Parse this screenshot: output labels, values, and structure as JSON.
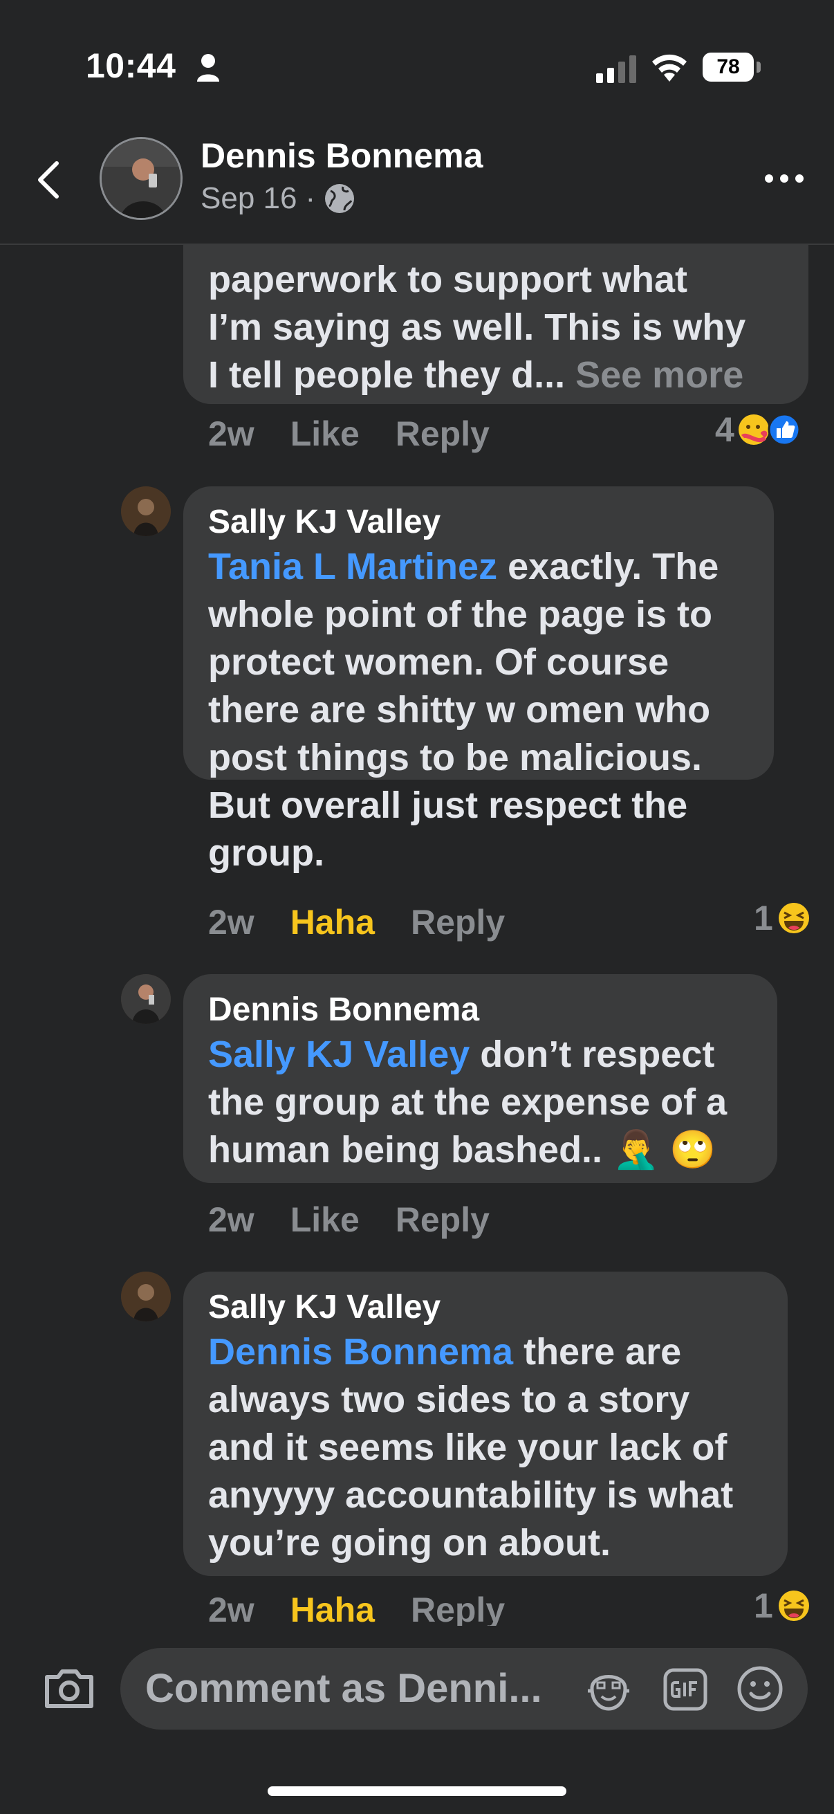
{
  "status_bar": {
    "time": "10:44",
    "battery": "78"
  },
  "header": {
    "name": "Dennis Bonnema",
    "date": "Sep 16",
    "separator": "·"
  },
  "comments": [
    {
      "lines": [
        "paperwork to support what",
        "I’m saying as well. This is why",
        "I tell people they d... "
      ],
      "see_more": "See more",
      "time": "2w",
      "action": "Like",
      "reply": "Reply",
      "reaction_count": "4"
    },
    {
      "author": "Sally KJ Valley",
      "mention": "Tania L Martinez",
      "text_first": " exactly. The",
      "lines": [
        "whole point of the page is to",
        "protect women. Of course",
        "there are shitty w omen who",
        "post things to be malicious.",
        "But overall just respect the",
        "group."
      ],
      "time": "2w",
      "action": "Haha",
      "reply": "Reply",
      "reaction_count": "1"
    },
    {
      "author": "Dennis Bonnema",
      "mention": "Sally KJ Valley",
      "text_first": " don’t respect",
      "lines": [
        "the group at the expense of a",
        "human being bashed.. 🤦‍♂️ 🙄"
      ],
      "time": "2w",
      "action": "Like",
      "reply": "Reply"
    },
    {
      "author": "Sally KJ Valley",
      "mention": "Dennis Bonnema",
      "text_first": " there are",
      "lines": [
        "always two sides to a story",
        "and it seems like your lack of",
        "anyyyy accountability is what",
        "you’re going on about."
      ],
      "time": "2w",
      "action": "Haha",
      "reply": "Reply",
      "reaction_count": "1"
    }
  ],
  "composer": {
    "placeholder": "Comment as Denni..."
  },
  "colors": {
    "background": "#242526",
    "bubble": "#3a3b3c",
    "mention": "#4599ff",
    "haha": "#f7c51d",
    "muted": "#8a8d91"
  }
}
